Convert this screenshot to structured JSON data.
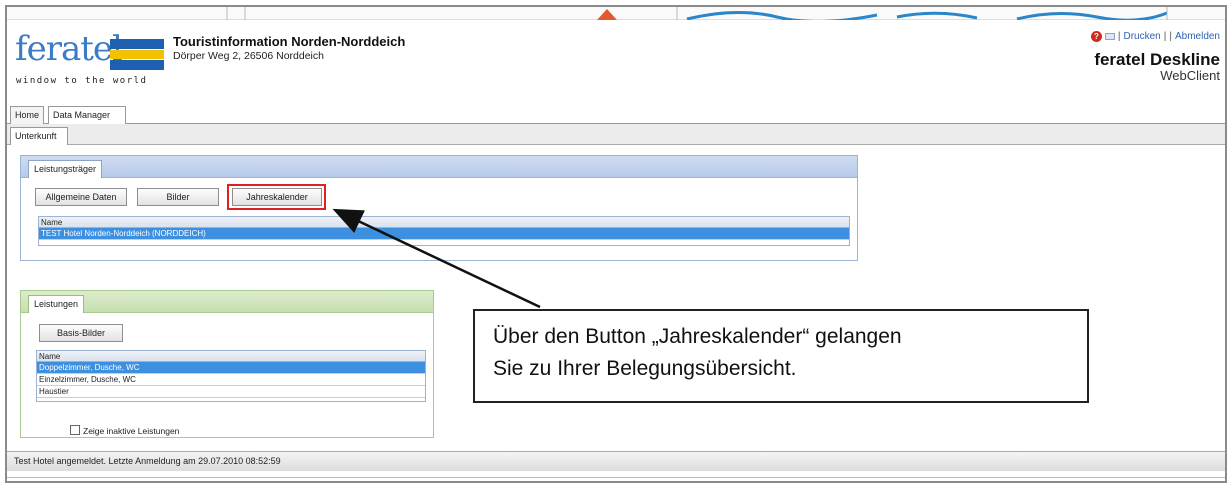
{
  "header": {
    "logo_word": "feratel",
    "logo_tagline": "window to the world",
    "org_title": "Touristinformation Norden-Norddeich",
    "org_address": "Dörper Weg 2, 26506 Norddeich",
    "links": {
      "separator": "|",
      "print": "Drucken",
      "logout": "Abmelden"
    },
    "brand_name": "feratel Deskline",
    "brand_sub": "WebClient"
  },
  "main_tabs": [
    {
      "label": "Home"
    },
    {
      "label": "Data Manager"
    }
  ],
  "sub_tabs": [
    {
      "label": "Unterkunft"
    }
  ],
  "provider_panel": {
    "tab_label": "Leistungsträger",
    "buttons": [
      {
        "label": "Allgemeine Daten"
      },
      {
        "label": "Bilder"
      },
      {
        "label": "Jahreskalender"
      }
    ],
    "grid_header": "Name",
    "rows": [
      {
        "name": "TEST Hotel Norden-Norddeich (NORDDEICH)",
        "selected": true
      }
    ]
  },
  "services_panel": {
    "tab_label": "Leistungen",
    "button_label": "Basis-Bilder",
    "grid_header": "Name",
    "rows": [
      {
        "name": "Doppelzimmer, Dusche, WC",
        "selected": true
      },
      {
        "name": "Einzelzimmer, Dusche, WC",
        "selected": false
      },
      {
        "name": "Haustier",
        "selected": false
      }
    ],
    "checkbox_label": "Zeige inaktive Leistungen"
  },
  "callout": {
    "line1": "Über den Button „Jahreskalender“ gelangen",
    "line2": "Sie zu Ihrer Belegungsübersicht."
  },
  "status": {
    "text": "Test Hotel angemeldet. Letzte Anmeldung am 29.07.2010 08:52:59"
  },
  "colors": {
    "accent_blue": "#3061b8",
    "selection_blue": "#3d8fe0",
    "highlight_red": "#e02020"
  }
}
